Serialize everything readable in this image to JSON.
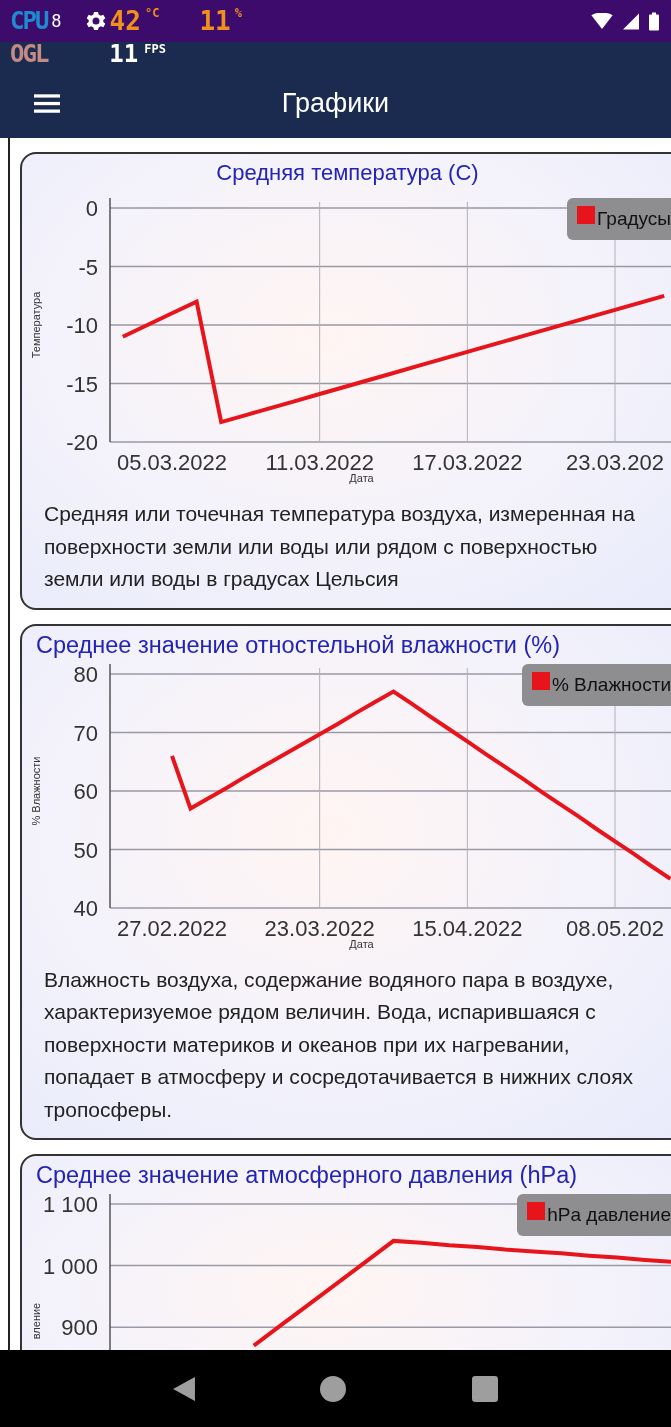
{
  "status_bar": {
    "cpu_label": "CPU",
    "cpu_cores": "8",
    "temperature": "42",
    "temperature_unit": "°C",
    "load": "11",
    "load_unit": "%"
  },
  "overlay": {
    "gl_label": "OGL",
    "fps": "11",
    "fps_unit": "FPS"
  },
  "app_bar": {
    "title": "Графики"
  },
  "cards": [
    {
      "title": "Средняя температура (С)",
      "chart_data": {
        "type": "line",
        "xlabel": "Дата",
        "ylabel": "Температура",
        "grid": true,
        "categories": [
          null,
          null,
          "05.03.2022",
          null,
          null,
          null,
          null,
          null,
          "11.03.2022",
          null,
          null,
          null,
          null,
          null,
          "17.03.2022",
          null,
          null,
          null,
          null,
          null,
          "23.03.202",
          null,
          null
        ],
        "series": [
          {
            "name": "Градусы",
            "color": "#e8141c",
            "values": [
              -11,
              -10,
              -9,
              -8,
              -18.3,
              -17.7,
              -17.1,
              -16.5,
              -15.9,
              -15.3,
              -14.7,
              -14.1,
              -13.5,
              -12.9,
              -12.3,
              -11.7,
              -11.1,
              -10.5,
              -9.9,
              -9.3,
              -8.7,
              -8.1,
              -7.5
            ]
          }
        ],
        "ylim": [
          -20,
          0
        ],
        "yticks": [
          {
            "value": 0,
            "label": "0"
          },
          {
            "value": -5,
            "label": "-5"
          },
          {
            "value": -10,
            "label": "-10"
          },
          {
            "value": -15,
            "label": "-15"
          },
          {
            "value": -20,
            "label": "-20"
          }
        ]
      },
      "description": "Средняя или точечная температура воздуха, измеренная на поверхности земли или воды или рядом с поверхностью земли или воды в градусах Цельсия"
    },
    {
      "title": "Среднее значение отностельной влажности (%)",
      "chart_data": {
        "type": "line",
        "xlabel": "Дата",
        "ylabel": "% Влажности",
        "grid": true,
        "categories": [
          null,
          null,
          "27.02.2022",
          null,
          null,
          null,
          null,
          null,
          null,
          null,
          "23.03.2022",
          null,
          null,
          null,
          null,
          null,
          null,
          null,
          "15.04.2022",
          null,
          null,
          null,
          null,
          null,
          null,
          null,
          "08.05.202",
          null,
          null,
          null
        ],
        "series": [
          {
            "name": "% Влажности",
            "color": "#e8141c",
            "values": [
              null,
              null,
              66,
              57,
              58.8,
              60.6,
              62.5,
              64.3,
              66.1,
              67.9,
              69.7,
              71.5,
              73.4,
              75.2,
              77,
              74.9,
              72.7,
              70.6,
              68.5,
              66.3,
              64.2,
              62.1,
              59.9,
              57.8,
              55.7,
              53.5,
              51.4,
              49.3,
              47.1,
              45
            ]
          }
        ],
        "ylim": [
          40,
          80
        ],
        "yticks": [
          {
            "value": 80,
            "label": "80"
          },
          {
            "value": 70,
            "label": "70"
          },
          {
            "value": 60,
            "label": "60"
          },
          {
            "value": 50,
            "label": "50"
          },
          {
            "value": 40,
            "label": "40"
          }
        ]
      },
      "description": "Влажность воздуха, содержание водяного пара в воздухе, характеризуемое рядом величин. Вода, испарившаяся с поверхности материков и океанов при их нагревании, попадает в атмосферу и сосредотачивается в нижних слоях тропосферы."
    },
    {
      "title": "Среднее значение атмосферного давления (hPa)",
      "chart_data": {
        "type": "line",
        "ylabel": "вление",
        "grid": true,
        "categories": [
          null,
          null,
          null,
          null,
          null,
          null,
          null,
          null,
          null,
          null,
          null,
          null,
          null,
          null,
          null,
          null,
          null,
          null,
          null,
          null,
          null
        ],
        "series": [
          {
            "name": "hPa давление",
            "color": "#e8141c",
            "values": [
              null,
              null,
              null,
              null,
              null,
              870,
              904,
              938,
              972,
              1006,
              1040,
              1037,
              1033,
              1030,
              1026,
              1023,
              1020,
              1016,
              1013,
              1009,
              1006
            ]
          }
        ],
        "ylim": [
          720,
          1100
        ],
        "yticks": [
          {
            "value": 1100,
            "label": "1 100"
          },
          {
            "value": 1000,
            "label": "1 000"
          },
          {
            "value": 900,
            "label": "900"
          }
        ]
      }
    }
  ]
}
